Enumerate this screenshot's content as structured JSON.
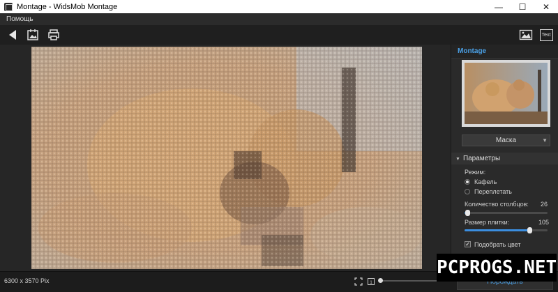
{
  "window": {
    "title": "Montage - WidsMob Montage",
    "minimize_icon": "minimize-icon",
    "maximize_icon": "maximize-icon",
    "close_icon": "close-icon"
  },
  "menu": {
    "items": [
      "Помощь"
    ]
  },
  "toolbar": {
    "back_icon": "back-arrow-icon",
    "add_image_icon": "add-image-icon",
    "print_icon": "printer-icon",
    "picture_icon": "picture-icon",
    "text_label": "Text"
  },
  "panel": {
    "title": "Montage",
    "mask_select": "Маска",
    "params_header": "Параметры",
    "mode_label": "Режим:",
    "modes": [
      {
        "label": "Кафель",
        "selected": true
      },
      {
        "label": "Переплетать",
        "selected": false
      }
    ],
    "columns_label": "Количество столбцов:",
    "columns_value": "26",
    "columns_fraction": 0.03,
    "tile_size_label": "Размер плитки:",
    "tile_size_value": "105",
    "tile_size_fraction": 0.78,
    "match_color_label": "Подобрать цвет",
    "match_color_checked": true
  },
  "status": {
    "dimensions": "6300 x 3570 Pix",
    "generate_button": "Порождать"
  },
  "watermark": {
    "text": "PCPROGS.NET"
  },
  "colors": {
    "accent": "#4aa0e6",
    "background": "#1e1e1e",
    "panel": "#2a2a2a"
  }
}
